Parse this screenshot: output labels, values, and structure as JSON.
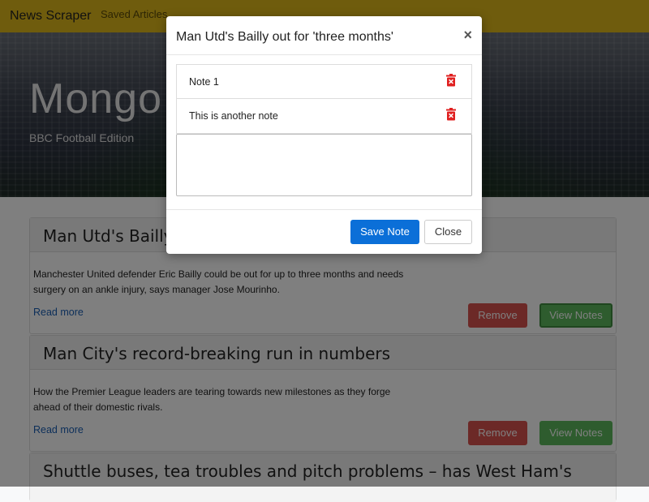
{
  "navbar": {
    "brand": "News Scraper",
    "links": [
      "Saved Articles"
    ]
  },
  "hero": {
    "title": "Mongo",
    "subtitle": "BBC Football Edition"
  },
  "articles": [
    {
      "title": "Man Utd's Bailly",
      "summary": "Manchester United defender Eric Bailly could be out for up to three months and needs surgery on an ankle injury, says manager Jose Mourinho.",
      "read_more": "Read more",
      "remove_label": "Remove",
      "notes_label": "View Notes"
    },
    {
      "title": "Man City's record-breaking run in numbers",
      "summary": "How the Premier League leaders are tearing towards new milestones as they forge ahead of their domestic rivals.",
      "read_more": "Read more",
      "remove_label": "Remove",
      "notes_label": "View Notes"
    },
    {
      "title": "Shuttle buses, tea troubles and pitch problems – has West Ham's"
    }
  ],
  "modal": {
    "title": "Man Utd's Bailly out for 'three months'",
    "close_glyph": "×",
    "notes": [
      {
        "text": "Note 1"
      },
      {
        "text": "This is another note"
      }
    ],
    "textarea_value": "",
    "save_label": "Save Note",
    "close_label": "Close"
  },
  "colors": {
    "navbar": "#dfb81b",
    "remove_button": "#d9534f",
    "notes_button": "#5cb85c",
    "save_button": "#0b6fd8",
    "trash_icon": "#e02020"
  },
  "icons": {
    "note_delete": "trash-icon"
  }
}
